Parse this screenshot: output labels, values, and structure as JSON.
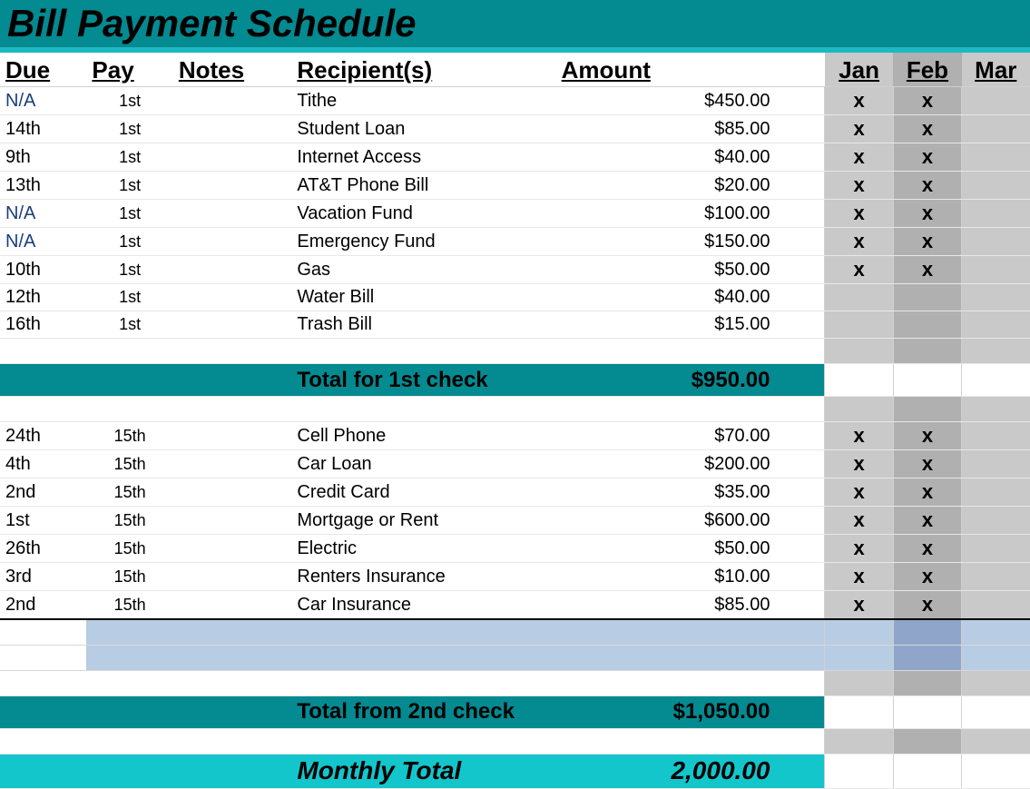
{
  "title": "Bill Payment Schedule",
  "headers": {
    "due": "Due",
    "pay": "Pay",
    "notes": "Notes",
    "recipient": "Recipient(s)",
    "amount": "Amount",
    "months": [
      "Jan",
      "Feb",
      "Mar"
    ]
  },
  "group1": {
    "rows": [
      {
        "due": "N/A",
        "due_na": true,
        "pay": "1st",
        "recipient": "Tithe",
        "amount": "$450.00",
        "jan": "x",
        "feb": "x",
        "mar": ""
      },
      {
        "due": "14th",
        "due_na": false,
        "pay": "1st",
        "recipient": "Student Loan",
        "amount": "$85.00",
        "jan": "x",
        "feb": "x",
        "mar": ""
      },
      {
        "due": "9th",
        "due_na": false,
        "pay": "1st",
        "recipient": "Internet Access",
        "amount": "$40.00",
        "jan": "x",
        "feb": "x",
        "mar": ""
      },
      {
        "due": "13th",
        "due_na": false,
        "pay": "1st",
        "recipient": "AT&T Phone Bill",
        "amount": "$20.00",
        "jan": "x",
        "feb": "x",
        "mar": ""
      },
      {
        "due": "N/A",
        "due_na": true,
        "pay": "1st",
        "recipient": "Vacation Fund",
        "amount": "$100.00",
        "jan": "x",
        "feb": "x",
        "mar": ""
      },
      {
        "due": "N/A",
        "due_na": true,
        "pay": "1st",
        "recipient": "Emergency Fund",
        "amount": "$150.00",
        "jan": "x",
        "feb": "x",
        "mar": ""
      },
      {
        "due": "10th",
        "due_na": false,
        "pay": "1st",
        "recipient": "Gas",
        "amount": "$50.00",
        "jan": "x",
        "feb": "x",
        "mar": ""
      },
      {
        "due": "12th",
        "due_na": false,
        "pay": "1st",
        "recipient": "Water Bill",
        "amount": "$40.00",
        "jan": "",
        "feb": "",
        "mar": ""
      },
      {
        "due": "16th",
        "due_na": false,
        "pay": "1st",
        "recipient": "Trash Bill",
        "amount": "$15.00",
        "jan": "",
        "feb": "",
        "mar": ""
      }
    ],
    "subtotal_label": "Total for 1st check",
    "subtotal_amount": "$950.00"
  },
  "group2": {
    "rows": [
      {
        "due": "24th",
        "pay": "15th",
        "recipient": "Cell Phone",
        "amount": "$70.00",
        "jan": "x",
        "feb": "x",
        "mar": ""
      },
      {
        "due": "4th",
        "pay": "15th",
        "recipient": "Car Loan",
        "amount": "$200.00",
        "jan": "x",
        "feb": "x",
        "mar": ""
      },
      {
        "due": "2nd",
        "pay": "15th",
        "recipient": "Credit Card",
        "amount": "$35.00",
        "jan": "x",
        "feb": "x",
        "mar": ""
      },
      {
        "due": "1st",
        "pay": "15th",
        "recipient": "Mortgage or Rent",
        "amount": "$600.00",
        "jan": "x",
        "feb": "x",
        "mar": ""
      },
      {
        "due": "26th",
        "pay": "15th",
        "recipient": "Electric",
        "amount": "$50.00",
        "jan": "x",
        "feb": "x",
        "mar": ""
      },
      {
        "due": "3rd",
        "pay": "15th",
        "recipient": "Renters Insurance",
        "amount": "$10.00",
        "jan": "x",
        "feb": "x",
        "mar": ""
      },
      {
        "due": "2nd",
        "pay": "15th",
        "recipient": "Car Insurance",
        "amount": "$85.00",
        "jan": "x",
        "feb": "x",
        "mar": ""
      }
    ],
    "subtotal_label": "Total from 2nd check",
    "subtotal_amount": "$1,050.00"
  },
  "grand": {
    "label": "Monthly Total",
    "amount": "2,000.00"
  }
}
